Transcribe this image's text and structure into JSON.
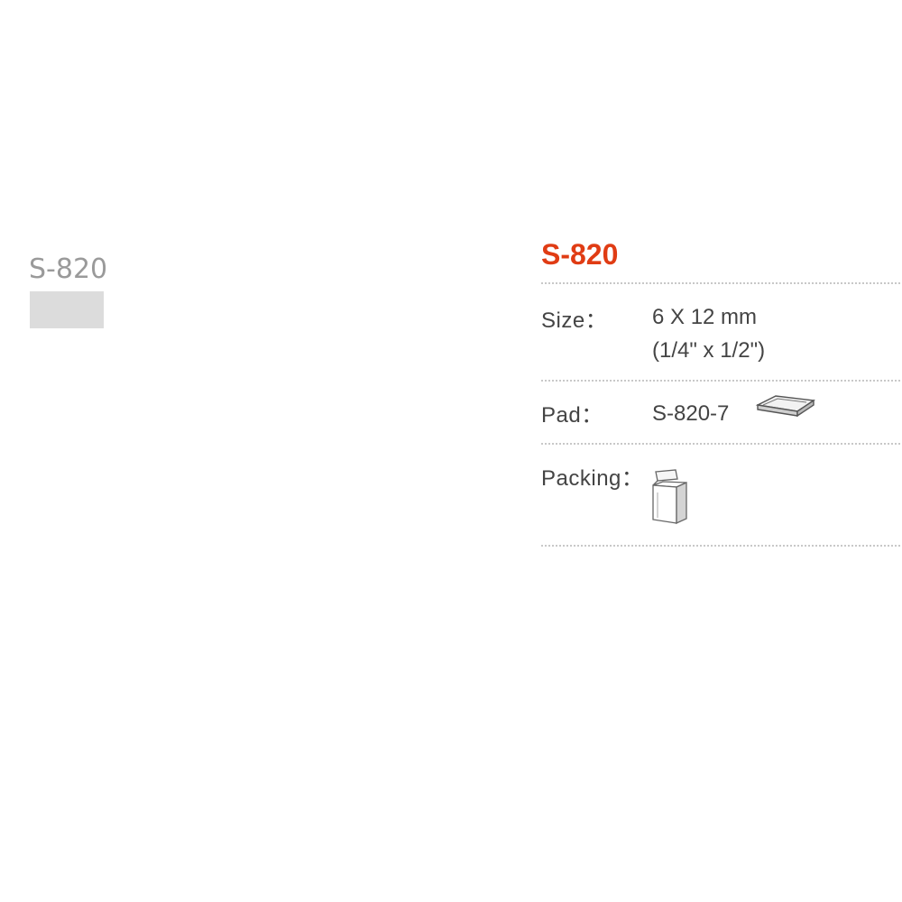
{
  "left_panel": {
    "model_label": "S-820",
    "swatch_color": "#dcdcdc"
  },
  "spec": {
    "title": "S-820",
    "title_color": "#e03c14",
    "rows": [
      {
        "label": "Size：",
        "values": [
          "6 X 12 mm",
          "(1/4\" x 1/2\")"
        ]
      },
      {
        "label": "Pad：",
        "values": [
          "S-820-7"
        ],
        "icon": "ink-pad-icon"
      },
      {
        "label": "Packing：",
        "values": [],
        "icon": "box-icon"
      }
    ]
  }
}
